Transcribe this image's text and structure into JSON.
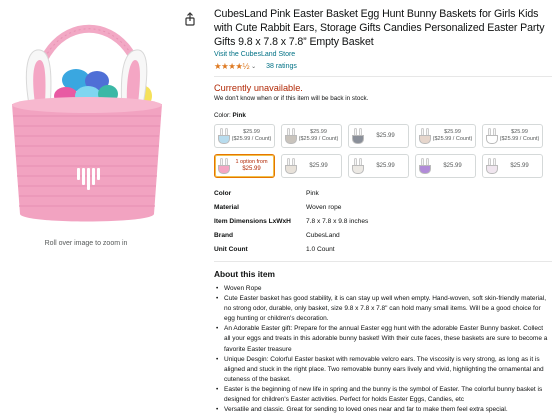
{
  "image": {
    "zoom_text": "Roll over image to zoom in"
  },
  "product": {
    "title": "CubesLand Pink Easter Basket Egg Hunt Bunny Baskets for Girls Kids with Cute Rabbit Ears, Storage Gifts Candies Personalized Easter Party Gifts 9.8 x 7.8 x 7.8” Empty Basket",
    "store_link": "Visit the CubesLand Store",
    "rating_stars": "★★★★½",
    "ratings_count": "38 ratings"
  },
  "availability": {
    "status": "Currently unavailable.",
    "note": "We don't know when or if this item will be back in stock."
  },
  "color_selector": {
    "label": "Color:",
    "selected": "Pink",
    "swatches": [
      {
        "line1": "$25.99",
        "line2": "($25.99 / Count)",
        "color": "#b8dcee"
      },
      {
        "line1": "$25.99",
        "line2": "($25.99 / Count)",
        "color": "#c9c4bd"
      },
      {
        "line1": "$25.99",
        "line2": "",
        "color": "#8a8f99"
      },
      {
        "line1": "$25.99",
        "line2": "($25.99 / Count)",
        "color": "#e6d6cc"
      },
      {
        "line1": "$25.99",
        "line2": "($25.99 / Count)",
        "color": "#ffffff"
      },
      {
        "line1": "1 option from",
        "line2": "$25.99",
        "color": "#f4a6c4"
      },
      {
        "line1": "$25.99",
        "line2": "",
        "color": "#e8e2da"
      },
      {
        "line1": "$25.99",
        "line2": "",
        "color": "#ece9e4"
      },
      {
        "line1": "$25.99",
        "line2": "",
        "color": "#b18bd8"
      },
      {
        "line1": "$25.99",
        "line2": "",
        "color": "#f0e6ef"
      }
    ]
  },
  "specs": [
    {
      "key": "Color",
      "value": "Pink"
    },
    {
      "key": "Material",
      "value": "Woven rope"
    },
    {
      "key": "Item Dimensions LxWxH",
      "value": "7.8 x 7.8 x 9.8 inches"
    },
    {
      "key": "Brand",
      "value": "CubesLand"
    },
    {
      "key": "Unit Count",
      "value": "1.0 Count"
    }
  ],
  "about": {
    "title": "About this item",
    "bullets": [
      "Woven Rope",
      "Cute Easter basket has good stability, it is can stay up well when empty. Hand-woven, soft skin-friendly material, no strong odor, durable, only basket, size 9.8 x 7.8 x 7.8\" can hold many small items. Will be a good choice for egg hunting or children's decoration.",
      "An Adorable Easter gift: Prepare for the annual Easter egg hunt with the adorable Easter Bunny basket. Collect all your eggs and treats in this adorable bunny basket! With their cute faces, these baskets are sure to become a favorite Easter treasure",
      "Unique Desgin: Colorful Easter basket with removable velcro ears. The viscosity is very strong, as long as it is aligned and stuck in the right place. Two removable bunny ears lively and vivid, highlighting the ornamental and cuteness of the basket.",
      "Easter is the beginning of new life in spring and the bunny is the symbol of Easter. The colorful bunny basket is designed for children's Easter activities. Perfect for holds Easter Eggs, Candies, etc",
      "Versatile and classic. Great for sending to loved ones near and far to make them feel extra special."
    ]
  }
}
